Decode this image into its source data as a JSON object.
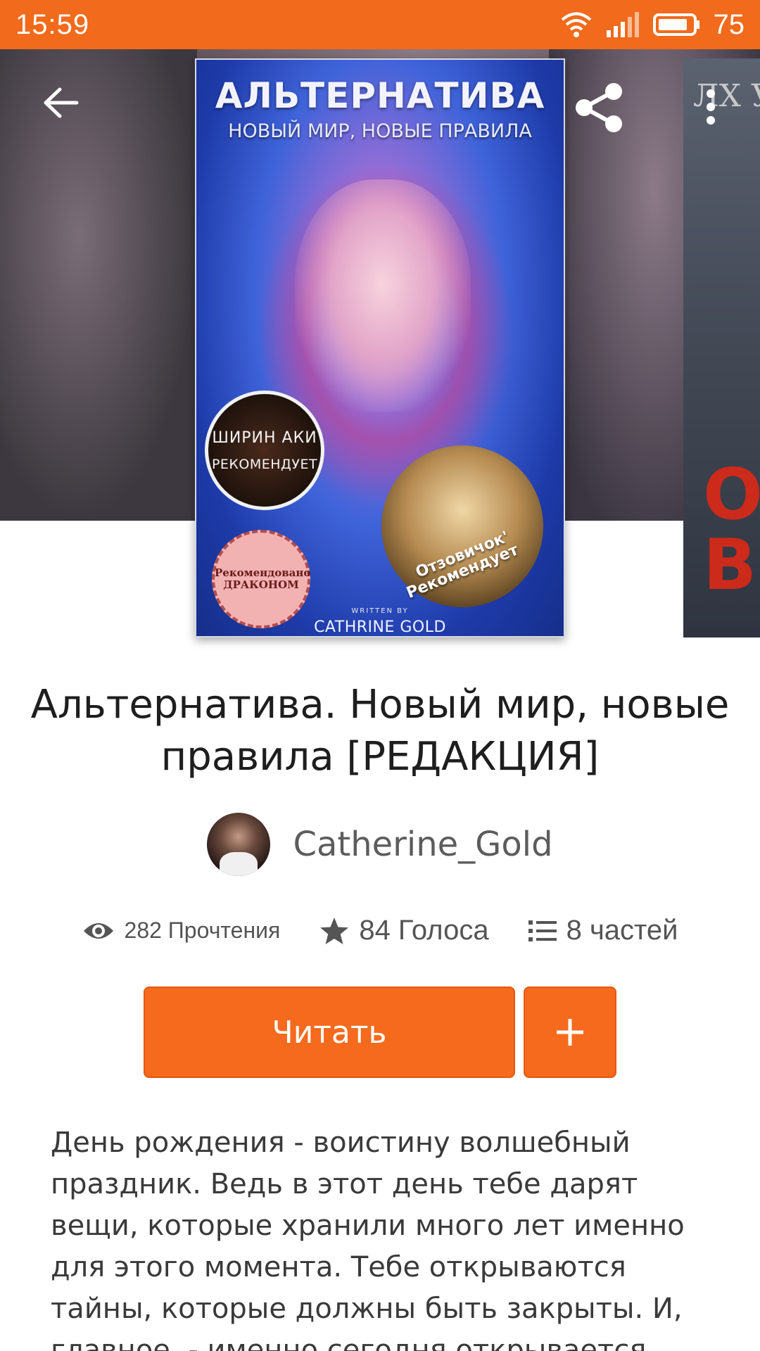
{
  "status_bar": {
    "time": "15:59",
    "battery": "75",
    "color": "#f26a1b"
  },
  "toolbar": {
    "back_icon": "arrow-left-icon",
    "share_icon": "share-icon",
    "more_icon": "more-vertical-icon"
  },
  "cover": {
    "title": "АЛЬТЕРНАТИВА",
    "subtitle": "НОВЫЙ МИР, НОВЫЕ ПРАВИЛА",
    "badge_top_1": "ШИРИН АКИ",
    "badge_top_2": "РЕКОМЕНДУЕТ",
    "badge_recommended_1": "Рекомендовано",
    "badge_recommended_2": "ДРАКОНОМ",
    "badge_heart_1": "Отзовичок'",
    "badge_heart_2": "Рекомендует",
    "written_by": "WRITTEN BY",
    "author": "CATHRINE GOLD"
  },
  "next_book": {
    "title_fragment": "ЛХ У",
    "red_fragment": "О\nВ"
  },
  "story": {
    "title": "Альтернатива. Новый мир, новые правила  [РЕДАКЦИЯ]",
    "author": "Catherine_Gold",
    "reads": "282 Прочтения",
    "votes": "84 Голоса",
    "parts": "8 частей",
    "description": "День рождения - воистину волшебный праздник. Ведь в этот день тебе дарят вещи, которые хранили много лет именно для этого момента. Тебе открываются тайны, которые должны быть закрыты. И, главное, - именно сегодня открывается портал в параллельную"
  },
  "actions": {
    "read_label": "Читать",
    "add_icon": "plus-icon",
    "accent": "#f66a1e"
  }
}
